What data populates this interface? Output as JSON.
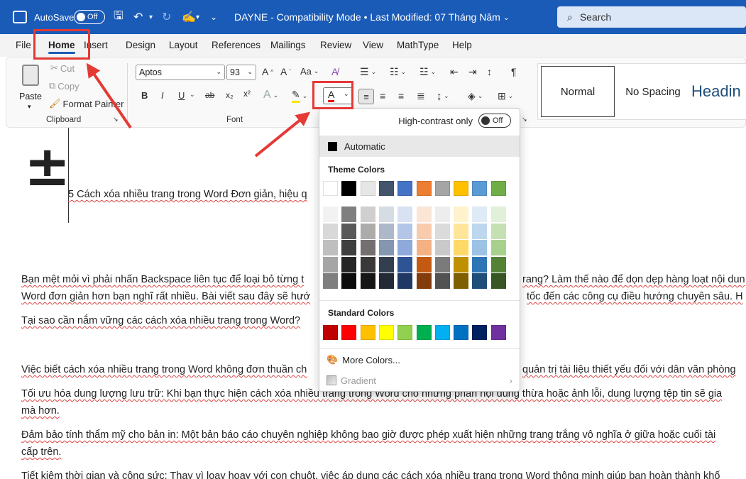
{
  "titlebar": {
    "autosave_label": "AutoSave",
    "autosave_state": "Off",
    "doc_title": "DAYNE - Compatibility Mode • Last Modified: 07 Tháng Năm",
    "search_placeholder": "Search"
  },
  "menu": [
    "File",
    "Home",
    "Insert",
    "Design",
    "Layout",
    "References",
    "Mailings",
    "Review",
    "View",
    "MathType",
    "Help"
  ],
  "ribbon": {
    "clipboard": {
      "paste": "Paste",
      "cut": "Cut",
      "copy": "Copy",
      "format_painter": "Format Painter",
      "label": "Clipboard"
    },
    "font": {
      "name": "Aptos",
      "size": "93",
      "label": "Font",
      "bold": "B",
      "italic": "I",
      "underline": "U",
      "strike": "ab",
      "subscript": "x₂",
      "superscript": "x²"
    },
    "styles": [
      "Normal",
      "No Spacing",
      "Headin"
    ]
  },
  "popup": {
    "high_contrast_label": "High-contrast only",
    "high_contrast_state": "Off",
    "automatic": "Automatic",
    "theme_colors_title": "Theme Colors",
    "standard_colors_title": "Standard Colors",
    "more_colors": "More Colors...",
    "gradient": "Gradient",
    "theme_top": [
      "#ffffff",
      "#000000",
      "#e7e6e6",
      "#44546a",
      "#4472c4",
      "#ed7d31",
      "#a5a5a5",
      "#ffc000",
      "#5b9bd5",
      "#70ad47"
    ],
    "theme_shades": [
      [
        "#f2f2f2",
        "#d8d8d8",
        "#bfbfbf",
        "#a5a5a5",
        "#7f7f7f"
      ],
      [
        "#7f7f7f",
        "#595959",
        "#3f3f3f",
        "#262626",
        "#0c0c0c"
      ],
      [
        "#d0cece",
        "#aeabab",
        "#757070",
        "#3a3838",
        "#171616"
      ],
      [
        "#d6dce4",
        "#adb9ca",
        "#8496b0",
        "#323f4f",
        "#222a35"
      ],
      [
        "#d9e2f3",
        "#b4c6e7",
        "#8eaadb",
        "#2f5496",
        "#1f3864"
      ],
      [
        "#fbe5d5",
        "#f7cbac",
        "#f4b183",
        "#c45911",
        "#833c0b"
      ],
      [
        "#ededed",
        "#dbdbdb",
        "#c9c9c9",
        "#7b7b7b",
        "#525252"
      ],
      [
        "#fff2cc",
        "#fee599",
        "#ffd966",
        "#bf9000",
        "#7f6000"
      ],
      [
        "#deebf6",
        "#bdd7ee",
        "#9cc3e5",
        "#2e75b5",
        "#1f4e79"
      ],
      [
        "#e2efd9",
        "#c5e0b3",
        "#a8d08d",
        "#538135",
        "#375623"
      ]
    ],
    "standard": [
      "#c00000",
      "#ff0000",
      "#ffc000",
      "#ffff00",
      "#92d050",
      "#00b050",
      "#00b0f0",
      "#0070c0",
      "#002060",
      "#7030a0"
    ]
  },
  "document": {
    "line1": "5 Cách xóa nhiều trang trong Word Đơn giản, hiệu q",
    "para1a": "Bạn mệt mỏi vì phải nhấn Backspace liên tục để loại bỏ từng t",
    "para1a_r": "rang? Làm thế nào để dọn dẹp hàng loạt nội dun",
    "para1b": "Word đơn giản hơn bạn nghĩ rất nhiều. Bài viết sau đây sẽ hướ",
    "para1b_r": "tốc đến các công cụ điều hướng chuyên sâu. H",
    "para2": "Tại sao cần nắm vững các cách xóa nhiều trang trong Word?",
    "para3a": "Việc biết cách xóa nhiều trang trong Word không đơn thuần ch",
    "para3a_r": "quản trị tài liệu thiết yếu đối với dân văn phòng",
    "para4a": "Tối ưu hóa dung lượng lưu trữ: Khi bạn thực hiện cách xóa nhiều trang trong Word cho những phần nội dung thừa hoặc ảnh lỗi, dung lượng tệp tin sẽ gia",
    "para4b": "mà hơn.",
    "para5a": "Đảm bảo tính thẩm mỹ cho bản in: Một bản báo cáo chuyên nghiệp không bao giờ được phép xuất hiện những trang trắng vô nghĩa ở giữa hoặc cuối tài",
    "para5b": "cấp trên.",
    "para6": "Tiết kiệm thời gian và công sức: Thay vì loay hoay với con chuột, việc áp dụng các cách xóa nhiều trang trong Word thông minh giúp bạn hoàn thành khố"
  },
  "colors": {
    "title_blue": "#1a5bb8",
    "highlight_red": "#e53935"
  }
}
